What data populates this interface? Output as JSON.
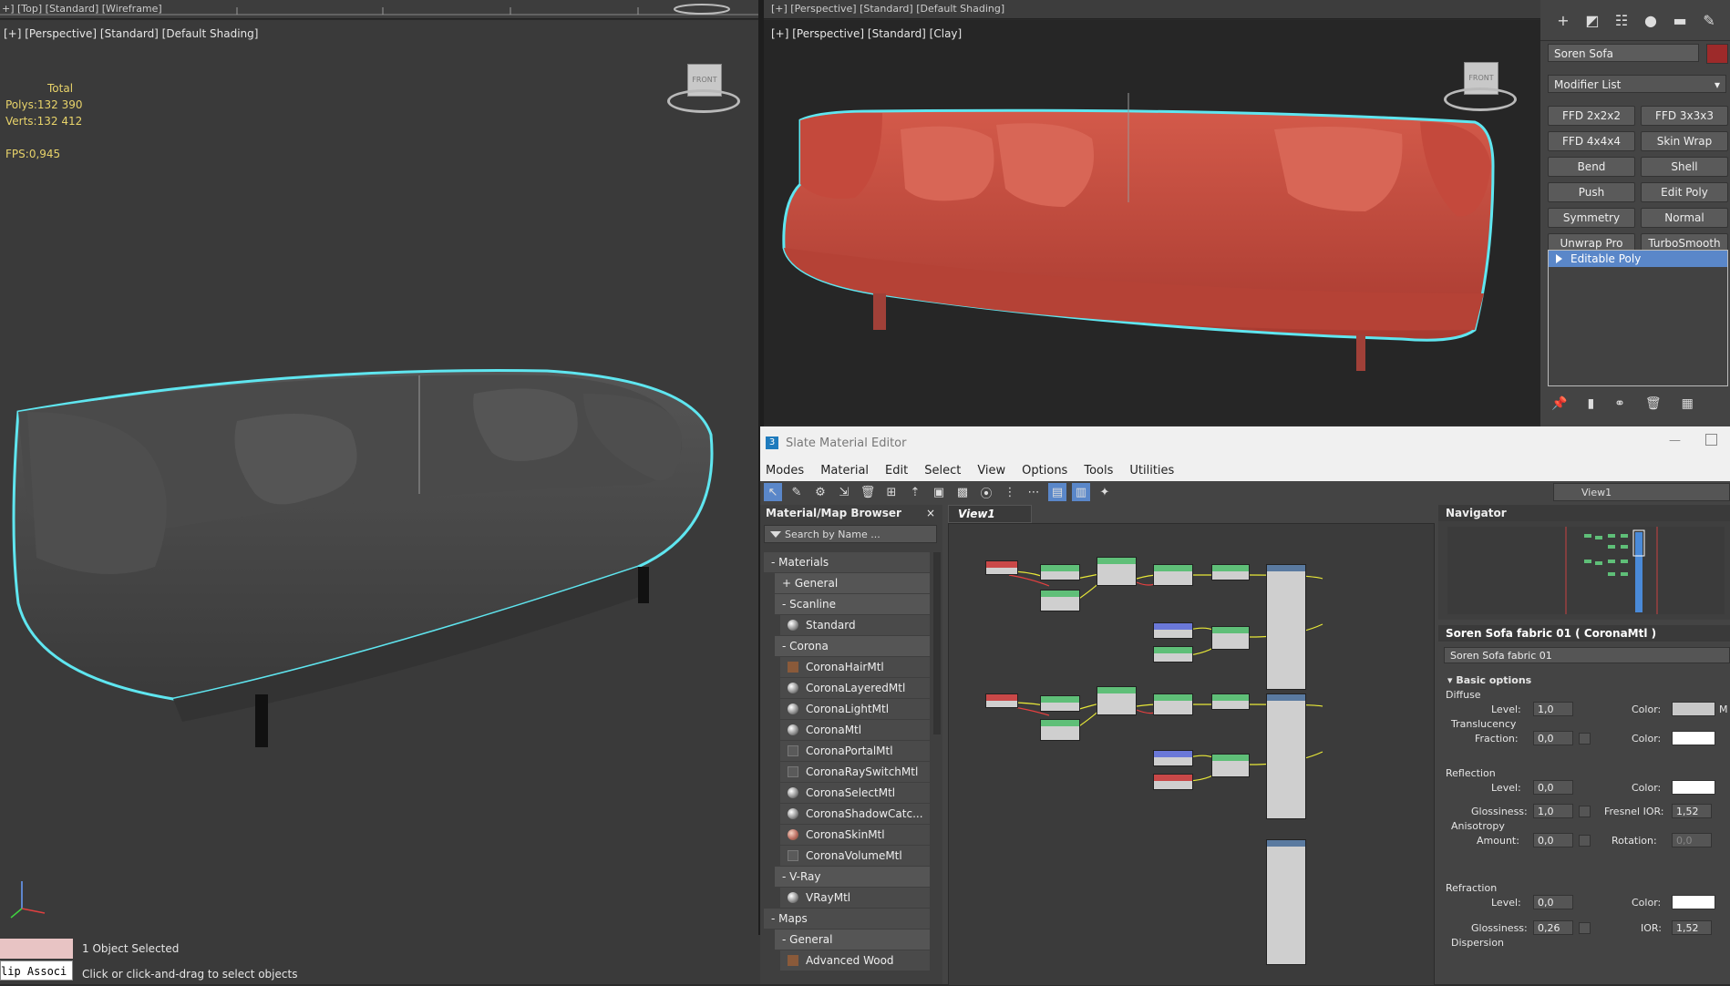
{
  "top_strip_left": "+] [Top] [Standard] [Wireframe]",
  "top_strip_right": "[+] [Perspective] [Standard] [Default Shading]",
  "viewport_left": {
    "label": "[+] [Perspective] [Standard] [Default Shading]",
    "stats": {
      "total_label": "Total",
      "polys_label": "Polys:",
      "polys_value": "132 390",
      "verts_label": "Verts:",
      "verts_value": "132 412",
      "fps_label": "FPS:",
      "fps_value": "0,945"
    }
  },
  "viewport_right": {
    "label": "[+] [Perspective] [Standard] [Clay]"
  },
  "command_panel": {
    "object_name": "Soren Sofa",
    "object_color": "#9d2a2a",
    "modifier_list_label": "Modifier List",
    "modifier_buttons": [
      "FFD 2x2x2",
      "FFD 3x3x3",
      "FFD 4x4x4",
      "Skin Wrap",
      "Bend",
      "Shell",
      "Push",
      "Edit Poly",
      "Symmetry",
      "Normal",
      "Unwrap Pro",
      "TurboSmooth"
    ],
    "stack_item": "Editable Poly"
  },
  "slate": {
    "title": "Slate Material Editor",
    "menu": [
      "Modes",
      "Material",
      "Edit",
      "Select",
      "View",
      "Options",
      "Tools",
      "Utilities"
    ],
    "view_selector": "View1",
    "browser": {
      "title": "Material/Map Browser",
      "close": "×",
      "search_placeholder": "Search by Name ...",
      "rows": [
        {
          "kind": "grp",
          "label": "- Materials"
        },
        {
          "kind": "sub",
          "label": "+ General"
        },
        {
          "kind": "sub",
          "label": "- Scanline"
        },
        {
          "kind": "mat",
          "label": "Standard",
          "icon": "sphere"
        },
        {
          "kind": "sub",
          "label": "- Corona"
        },
        {
          "kind": "mat",
          "label": "CoronaHairMtl",
          "icon": "hair"
        },
        {
          "kind": "mat",
          "label": "CoronaLayeredMtl",
          "icon": "sphere"
        },
        {
          "kind": "mat",
          "label": "CoronaLightMtl",
          "icon": "sphere"
        },
        {
          "kind": "mat",
          "label": "CoronaMtl",
          "icon": "sphere"
        },
        {
          "kind": "mat",
          "label": "CoronaPortalMtl",
          "icon": "square"
        },
        {
          "kind": "mat",
          "label": "CoronaRaySwitchMtl",
          "icon": "square"
        },
        {
          "kind": "mat",
          "label": "CoronaSelectMtl",
          "icon": "sphere"
        },
        {
          "kind": "mat",
          "label": "CoronaShadowCatc...",
          "icon": "sphere"
        },
        {
          "kind": "mat",
          "label": "CoronaSkinMtl",
          "icon": "skin"
        },
        {
          "kind": "mat",
          "label": "CoronaVolumeMtl",
          "icon": "square"
        },
        {
          "kind": "sub",
          "label": "- V-Ray"
        },
        {
          "kind": "mat",
          "label": "VRayMtl",
          "icon": "sphere"
        },
        {
          "kind": "grp",
          "label": "- Maps"
        },
        {
          "kind": "sub",
          "label": "- General"
        },
        {
          "kind": "mat",
          "label": "Advanced Wood",
          "icon": "hair"
        }
      ]
    },
    "view_tab": "View1",
    "navigator_title": "Navigator",
    "props": {
      "header": "Soren Sofa fabric 01  ( CoronaMtl )",
      "material_name": "Soren Sofa fabric 01",
      "basic_options": "Basic options",
      "diffuse": "Diffuse",
      "level_label": "Level:",
      "diffuse_level": "1,0",
      "color_label": "Color:",
      "diffuse_m": "M",
      "translucency": "Translucency",
      "fraction_label": "Fraction:",
      "translucency_fraction": "0,0",
      "reflection": "Reflection",
      "reflection_level": "0,0",
      "glossiness_label": "Glossiness:",
      "reflection_glossiness": "1,0",
      "fresnel_label": "Fresnel IOR:",
      "fresnel_value": "1,52",
      "anisotropy": "Anisotropy",
      "amount_label": "Amount:",
      "aniso_amount": "0,0",
      "rotation_label": "Rotation:",
      "aniso_rotation": "0,0",
      "refraction": "Refraction",
      "refraction_level": "0,0",
      "refraction_glossiness": "0,26",
      "ior_label": "IOR:",
      "ior_value": "1,52",
      "dispersion": "Dispersion",
      "diffuse_swatch": "#c8c8c8",
      "white_swatch": "#ffffff"
    }
  },
  "status": {
    "line1": "1 Object Selected",
    "line2": "Click or click-and-drag to select objects",
    "mini_input": "lip Associ"
  }
}
